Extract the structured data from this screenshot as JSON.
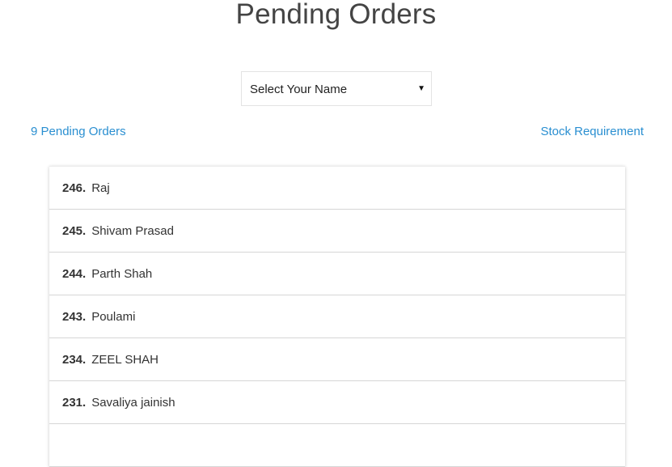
{
  "page": {
    "title": "Pending Orders"
  },
  "select": {
    "selected_value": "Select Your Name",
    "caret_icon": "caret-down-icon"
  },
  "links": {
    "pending_count": "9 Pending Orders",
    "stock_requirement": "Stock Requirement"
  },
  "colors": {
    "link": "#2a8fd1",
    "row_border": "#d6d6d6"
  },
  "orders": [
    {
      "id": "246",
      "name": "Raj"
    },
    {
      "id": "245",
      "name": "Shivam Prasad"
    },
    {
      "id": "244",
      "name": "Parth Shah"
    },
    {
      "id": "243",
      "name": "Poulami"
    },
    {
      "id": "234",
      "name": "ZEEL SHAH"
    },
    {
      "id": "231",
      "name": "Savaliya jainish"
    },
    {
      "id": "",
      "name": ""
    }
  ]
}
